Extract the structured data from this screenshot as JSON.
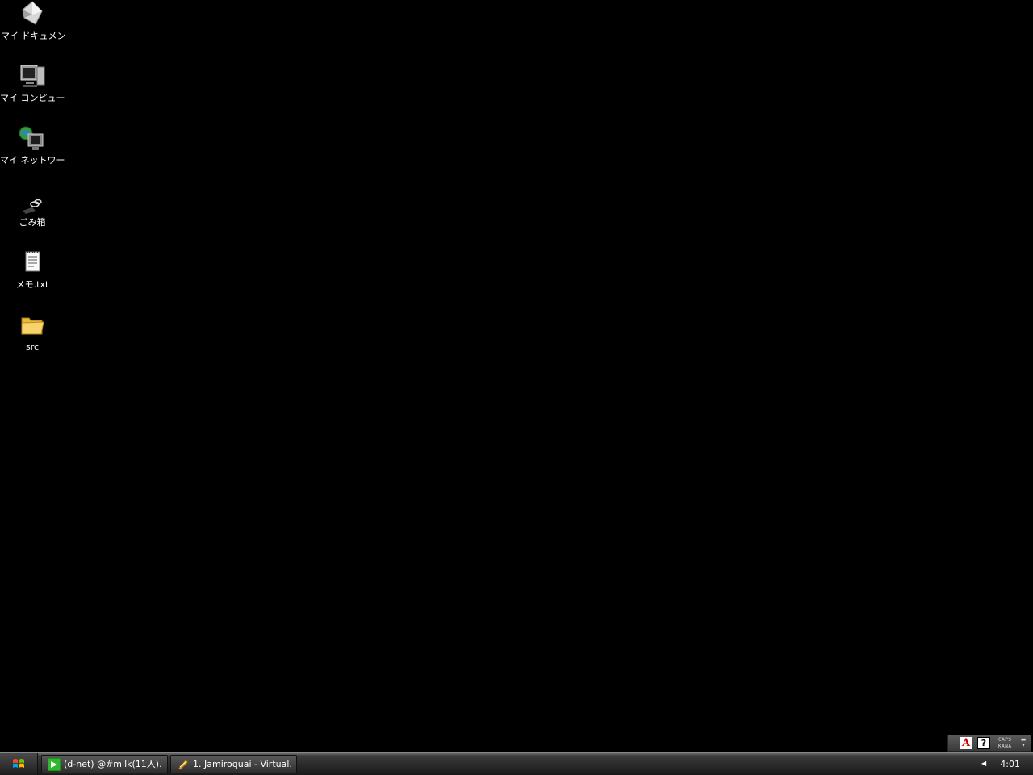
{
  "desktop": {
    "icons": [
      {
        "label": "マイ ドキュメント",
        "icon": "my-documents-icon",
        "selected": true
      },
      {
        "label": "マイ コンピュータ",
        "icon": "my-computer-icon"
      },
      {
        "label": "マイ ネットワーク",
        "icon": "my-network-icon"
      },
      {
        "label": "ごみ箱",
        "icon": "recycle-bin-icon"
      },
      {
        "label": "メモ.txt",
        "icon": "text-file-icon"
      },
      {
        "label": "src",
        "icon": "folder-icon"
      }
    ]
  },
  "langbar": {
    "ime_glyph": "A",
    "help_glyph": "?",
    "caps": "CAPS",
    "kana": "KANA"
  },
  "taskbar": {
    "tasks": [
      {
        "label": "(d-net) @#milk(11人)...",
        "icon": "chat-client-icon"
      },
      {
        "label": "1. Jamiroquai - Virtual...",
        "icon": "media-player-icon"
      }
    ],
    "clock": "4:01"
  },
  "colors": {
    "desktop_bg": "#000000",
    "taskbar_bg": "#2a2a2a",
    "label_text": "#ffffff"
  }
}
